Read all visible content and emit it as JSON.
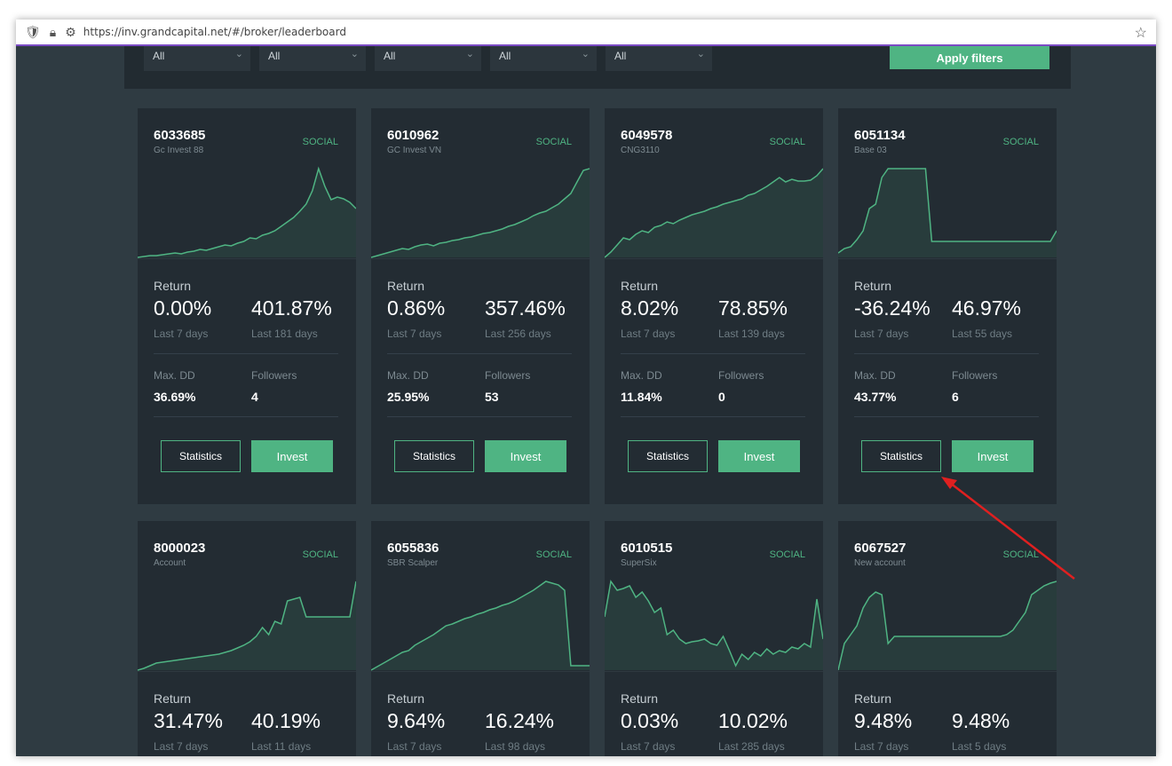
{
  "browser": {
    "url": "https://inv.grandcapital.net/#/broker/leaderboard"
  },
  "filters": {
    "selects": [
      "All",
      "All",
      "All",
      "All",
      "All"
    ],
    "apply_label": "Apply filters"
  },
  "labels": {
    "return": "Return",
    "last_7": "Last 7 days",
    "max_dd": "Max. DD",
    "followers": "Followers",
    "statistics": "Statistics",
    "invest": "Invest"
  },
  "colors": {
    "accent": "#4fb483",
    "card_bg": "#232c33",
    "page_bg": "#2f3b42",
    "annotation_arrow": "#e02020"
  },
  "cards": [
    {
      "account": "6033685",
      "name": "Gc Invest 88",
      "tag": "SOCIAL",
      "ret7": "0.00%",
      "retAll": "401.87%",
      "lastAll": "Last 181 days",
      "maxdd": "36.69%",
      "followers": "4",
      "curve": [
        0.0,
        0.01,
        0.02,
        0.02,
        0.03,
        0.04,
        0.05,
        0.04,
        0.06,
        0.07,
        0.09,
        0.08,
        0.1,
        0.12,
        0.14,
        0.13,
        0.16,
        0.18,
        0.22,
        0.21,
        0.25,
        0.27,
        0.3,
        0.35,
        0.4,
        0.45,
        0.52,
        0.6,
        0.75,
        1.0,
        0.8,
        0.65,
        0.68,
        0.66,
        0.62,
        0.55
      ]
    },
    {
      "account": "6010962",
      "name": "GC Invest VN",
      "tag": "SOCIAL",
      "ret7": "0.86%",
      "retAll": "357.46%",
      "lastAll": "Last 256 days",
      "maxdd": "25.95%",
      "followers": "53",
      "curve": [
        0.0,
        0.02,
        0.04,
        0.06,
        0.08,
        0.1,
        0.09,
        0.12,
        0.14,
        0.15,
        0.13,
        0.16,
        0.17,
        0.19,
        0.2,
        0.22,
        0.23,
        0.25,
        0.27,
        0.28,
        0.3,
        0.32,
        0.35,
        0.37,
        0.4,
        0.43,
        0.47,
        0.5,
        0.52,
        0.56,
        0.6,
        0.66,
        0.72,
        0.85,
        0.98,
        1.0
      ]
    },
    {
      "account": "6049578",
      "name": "CNG3110",
      "tag": "SOCIAL",
      "ret7": "8.02%",
      "retAll": "78.85%",
      "lastAll": "Last 139 days",
      "maxdd": "11.84%",
      "followers": "0",
      "curve": [
        0.0,
        0.06,
        0.14,
        0.22,
        0.2,
        0.26,
        0.3,
        0.28,
        0.34,
        0.36,
        0.4,
        0.38,
        0.42,
        0.45,
        0.48,
        0.5,
        0.52,
        0.55,
        0.57,
        0.6,
        0.62,
        0.64,
        0.66,
        0.7,
        0.72,
        0.76,
        0.8,
        0.85,
        0.9,
        0.85,
        0.88,
        0.86,
        0.86,
        0.87,
        0.92,
        1.0
      ]
    },
    {
      "account": "6051134",
      "name": "Base 03",
      "tag": "SOCIAL",
      "ret7": "-36.24%",
      "retAll": "46.97%",
      "lastAll": "Last 55 days",
      "maxdd": "43.77%",
      "followers": "6",
      "curve": [
        0.05,
        0.1,
        0.12,
        0.2,
        0.3,
        0.55,
        0.6,
        0.9,
        1.0,
        1.0,
        1.0,
        1.0,
        1.0,
        1.0,
        1.0,
        0.18,
        0.18,
        0.18,
        0.18,
        0.18,
        0.18,
        0.18,
        0.18,
        0.18,
        0.18,
        0.18,
        0.18,
        0.18,
        0.18,
        0.18,
        0.18,
        0.18,
        0.18,
        0.18,
        0.18,
        0.3
      ]
    },
    {
      "account": "8000023",
      "name": "Account",
      "tag": "SOCIAL",
      "ret7": "31.47%",
      "retAll": "40.19%",
      "lastAll": "Last 11 days",
      "maxdd": "",
      "followers": "",
      "curve": [
        0.0,
        0.02,
        0.05,
        0.08,
        0.09,
        0.1,
        0.11,
        0.12,
        0.13,
        0.14,
        0.15,
        0.16,
        0.17,
        0.18,
        0.2,
        0.22,
        0.25,
        0.28,
        0.32,
        0.38,
        0.48,
        0.4,
        0.55,
        0.52,
        0.78,
        0.8,
        0.82,
        0.6,
        0.6,
        0.6,
        0.6,
        0.6,
        0.6,
        0.6,
        0.6,
        1.0
      ]
    },
    {
      "account": "6055836",
      "name": "SBR Scalper",
      "tag": "SOCIAL",
      "ret7": "9.64%",
      "retAll": "16.24%",
      "lastAll": "Last 98 days",
      "maxdd": "",
      "followers": "",
      "curve": [
        0.0,
        0.04,
        0.08,
        0.12,
        0.16,
        0.2,
        0.22,
        0.28,
        0.32,
        0.36,
        0.4,
        0.45,
        0.5,
        0.52,
        0.55,
        0.58,
        0.6,
        0.63,
        0.65,
        0.68,
        0.7,
        0.73,
        0.75,
        0.78,
        0.82,
        0.86,
        0.9,
        0.95,
        1.0,
        0.98,
        0.96,
        0.9,
        0.05,
        0.05,
        0.05,
        0.05
      ]
    },
    {
      "account": "6010515",
      "name": "SuperSix",
      "tag": "SOCIAL",
      "ret7": "0.03%",
      "retAll": "10.02%",
      "lastAll": "Last 285 days",
      "maxdd": "",
      "followers": "",
      "curve": [
        0.6,
        1.0,
        0.9,
        0.92,
        0.95,
        0.82,
        0.88,
        0.78,
        0.65,
        0.7,
        0.4,
        0.45,
        0.35,
        0.3,
        0.32,
        0.33,
        0.35,
        0.3,
        0.28,
        0.38,
        0.22,
        0.05,
        0.18,
        0.12,
        0.2,
        0.16,
        0.24,
        0.18,
        0.22,
        0.2,
        0.26,
        0.24,
        0.3,
        0.26,
        0.8,
        0.35
      ]
    },
    {
      "account": "6067527",
      "name": "New account",
      "tag": "SOCIAL",
      "ret7": "9.48%",
      "retAll": "9.48%",
      "lastAll": "Last 5 days",
      "maxdd": "",
      "followers": "",
      "curve": [
        0.0,
        0.3,
        0.4,
        0.5,
        0.7,
        0.82,
        0.88,
        0.85,
        0.3,
        0.38,
        0.38,
        0.38,
        0.38,
        0.38,
        0.38,
        0.38,
        0.38,
        0.38,
        0.38,
        0.38,
        0.38,
        0.38,
        0.38,
        0.38,
        0.38,
        0.38,
        0.38,
        0.4,
        0.45,
        0.55,
        0.65,
        0.85,
        0.9,
        0.95,
        0.98,
        1.0
      ]
    }
  ]
}
